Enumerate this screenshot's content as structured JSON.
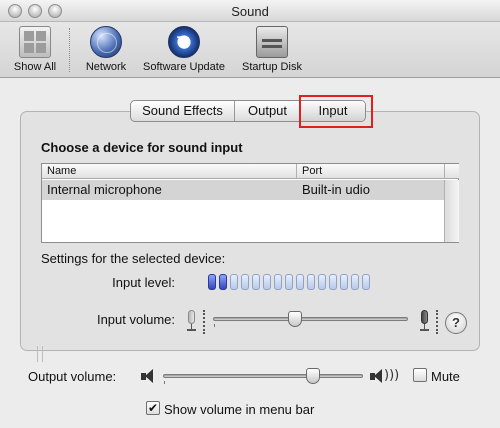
{
  "window": {
    "title": "Sound"
  },
  "toolbar": {
    "items": [
      {
        "label": "Show All",
        "icon": "show-all-icon"
      },
      {
        "label": "Network",
        "icon": "network-icon"
      },
      {
        "label": "Software Update",
        "icon": "software-update-icon"
      },
      {
        "label": "Startup Disk",
        "icon": "startup-disk-icon"
      }
    ]
  },
  "tabs": [
    {
      "label": "Sound Effects",
      "selected": false
    },
    {
      "label": "Output",
      "selected": false
    },
    {
      "label": "Input",
      "selected": true
    }
  ],
  "input_panel": {
    "heading": "Choose a device for sound input",
    "table": {
      "columns": [
        "Name",
        "Port"
      ],
      "rows": [
        {
          "name": "Internal microphone",
          "port": "Built-in   udio",
          "selected": true
        }
      ]
    },
    "settings_label": "Settings for the selected device:",
    "input_level_label": "Input level:",
    "input_level": {
      "segments_total": 15,
      "segments_lit": 2
    },
    "input_volume_label": "Input volume:",
    "input_volume": 0.42,
    "help_label": "?"
  },
  "output": {
    "volume_label": "Output volume:",
    "volume": 0.75,
    "mute_label": "Mute",
    "mute_checked": false,
    "menu_bar_label": "Show volume in menu bar",
    "menu_bar_checked": true,
    "check_glyph": "✔"
  },
  "colors": {
    "highlight": "#e02020",
    "level_on": "#3345b8"
  }
}
